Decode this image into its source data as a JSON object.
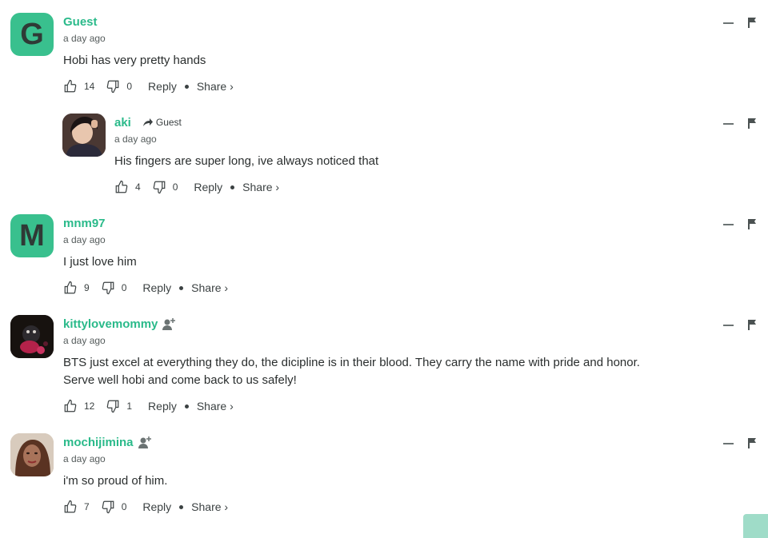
{
  "comments": [
    {
      "author": "Guest",
      "avatar_letter": "G",
      "time": "a day ago",
      "text": "Hobi has very pretty hands",
      "upvotes": "14",
      "downvotes": "0",
      "reply": "Reply",
      "share": "Share ›"
    },
    {
      "author": "aki",
      "reply_to": "Guest",
      "time": "a day ago",
      "text": "His fingers are super long, ive always noticed that",
      "upvotes": "4",
      "downvotes": "0",
      "reply": "Reply",
      "share": "Share ›"
    },
    {
      "author": "mnm97",
      "avatar_letter": "M",
      "time": "a day ago",
      "text": "I just love him",
      "upvotes": "9",
      "downvotes": "0",
      "reply": "Reply",
      "share": "Share ›"
    },
    {
      "author": "kittylovemommy",
      "time": "a day ago",
      "text_lines": [
        "BTS just excel at everything they do, the dicipline is in their blood. They carry the name with pride and honor.",
        "Serve well hobi and come back to us safely!"
      ],
      "upvotes": "12",
      "downvotes": "1",
      "reply": "Reply",
      "share": "Share ›"
    },
    {
      "author": "mochijimina",
      "time": "a day ago",
      "text": "i'm so proud of him.",
      "upvotes": "7",
      "downvotes": "0",
      "reply": "Reply",
      "share": "Share ›"
    }
  ],
  "icons": {
    "upvote": "thumbs-up-icon",
    "downvote": "thumbs-down-icon",
    "collapse": "minus-icon",
    "flag": "flag-icon",
    "reply_to": "arrow-reply-icon",
    "follow": "add-user-icon"
  },
  "colors": {
    "accent": "#2aba8a",
    "avatar_bg": "#39c08e",
    "text": "#2a2e2e"
  }
}
